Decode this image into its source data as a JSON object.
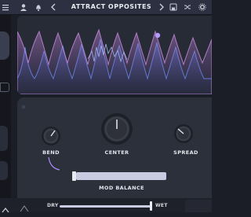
{
  "header": {
    "preset_name": "ATTRACT OPPOSITES",
    "icons": [
      "menu-icon",
      "user-icon",
      "bell-icon",
      "prev-icon",
      "next-icon",
      "save-icon",
      "shuffle-icon",
      "settings-icon"
    ]
  },
  "knobs": {
    "bend": {
      "label": "BEND"
    },
    "center": {
      "label": "CENTER"
    },
    "spread": {
      "label": "SPREAD"
    }
  },
  "mod_balance": {
    "label": "MOD BALANCE"
  },
  "mix": {
    "dry_label": "DRY",
    "wet_label": "WET",
    "value": 0.9
  },
  "colors": {
    "accent": "#a78bfa",
    "wave_blue": "#5b7fd6",
    "wave_pink": "#c98be0"
  }
}
